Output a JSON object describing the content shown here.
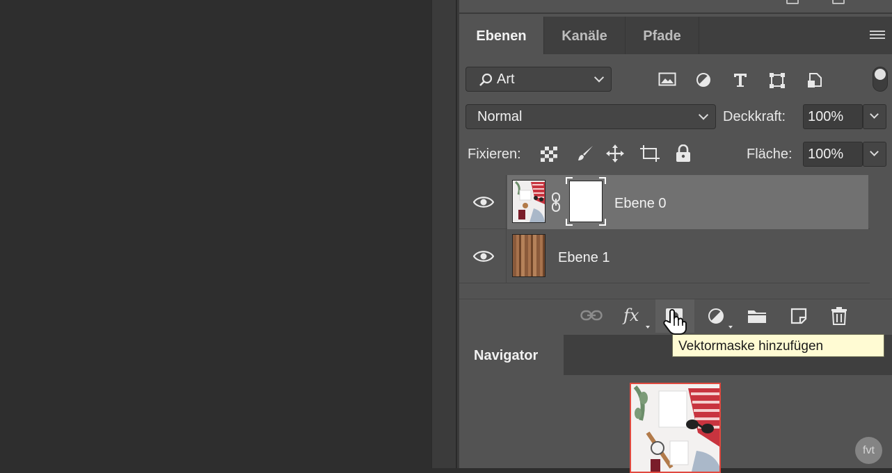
{
  "layers_panel": {
    "tabs": [
      {
        "label": "Ebenen",
        "active": true
      },
      {
        "label": "Kanäle",
        "active": false
      },
      {
        "label": "Pfade",
        "active": false
      }
    ],
    "filter": {
      "value": "Art",
      "icon": "search-icon"
    },
    "filter_icons": [
      "image-filter-icon",
      "adjustment-filter-icon",
      "type-filter-icon",
      "shape-filter-icon",
      "smart-object-filter-icon"
    ],
    "blend_mode": "Normal",
    "opacity": {
      "label": "Deckkraft:",
      "value": "100%"
    },
    "lock": {
      "label": "Fixieren:",
      "icons": [
        "lock-transparent-icon",
        "lock-image-icon",
        "lock-position-icon",
        "lock-artboard-icon",
        "lock-all-icon"
      ]
    },
    "fill": {
      "label": "Fläche:",
      "value": "100%"
    },
    "layers": [
      {
        "name": "Ebene 0",
        "visible": true,
        "selected": true,
        "has_mask": true
      },
      {
        "name": "Ebene 1",
        "visible": true,
        "selected": false,
        "has_mask": false
      }
    ],
    "bottom_icons": [
      "link-layers-icon",
      "fx-icon",
      "add-mask-icon",
      "adjustment-layer-icon",
      "group-folder-icon",
      "new-layer-icon",
      "trash-icon"
    ],
    "fx_label": "fx"
  },
  "tooltip": "Vektormaske hinzufügen",
  "navigator": {
    "tab": "Navigator"
  },
  "watermark": "fvt",
  "colors": {
    "panel": "#535353",
    "tab_bar": "#3f3f3f",
    "selected_layer": "#717171",
    "tooltip_bg": "#fffbd3",
    "nav_frame": "#e0493f"
  }
}
